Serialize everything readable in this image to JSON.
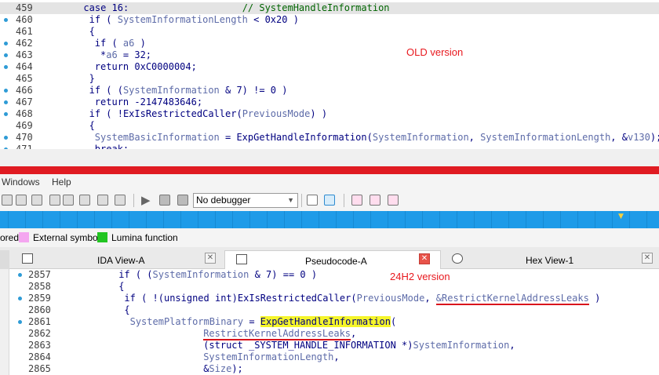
{
  "old_pane": {
    "annotation": "OLD version",
    "lines": [
      {
        "num": "459",
        "dot": false,
        "indent": 14,
        "parts": [
          [
            "kw",
            "case 16:"
          ],
          [
            "sp",
            "                    "
          ],
          [
            "com",
            "// SystemHandleInformation"
          ]
        ]
      },
      {
        "num": "460",
        "dot": true,
        "indent": 16,
        "parts": [
          [
            "kw",
            "if ( "
          ],
          [
            "var",
            "SystemInformationLength"
          ],
          [
            "kw",
            " < 0x20 )"
          ]
        ]
      },
      {
        "num": "461",
        "dot": false,
        "indent": 16,
        "parts": [
          [
            "kw",
            "{"
          ]
        ]
      },
      {
        "num": "462",
        "dot": true,
        "indent": 18,
        "parts": [
          [
            "kw",
            "if ( "
          ],
          [
            "var",
            "a6"
          ],
          [
            "kw",
            " )"
          ]
        ]
      },
      {
        "num": "463",
        "dot": true,
        "indent": 20,
        "parts": [
          [
            "kw",
            "*"
          ],
          [
            "var",
            "a6"
          ],
          [
            "kw",
            " = 32;"
          ]
        ]
      },
      {
        "num": "464",
        "dot": true,
        "indent": 18,
        "parts": [
          [
            "kw",
            "return 0xC0000004;"
          ]
        ]
      },
      {
        "num": "465",
        "dot": false,
        "indent": 16,
        "parts": [
          [
            "kw",
            "}"
          ]
        ]
      },
      {
        "num": "466",
        "dot": true,
        "indent": 16,
        "parts": [
          [
            "kw",
            "if ( ("
          ],
          [
            "var",
            "SystemInformation"
          ],
          [
            "kw",
            " & 7) != 0 )"
          ]
        ]
      },
      {
        "num": "467",
        "dot": true,
        "indent": 18,
        "parts": [
          [
            "kw",
            "return -2147483646;"
          ]
        ]
      },
      {
        "num": "468",
        "dot": true,
        "indent": 16,
        "parts": [
          [
            "kw",
            "if ( !"
          ],
          [
            "fn",
            "ExIsRestrictedCaller"
          ],
          [
            "kw",
            "("
          ],
          [
            "var",
            "PreviousMode"
          ],
          [
            "kw",
            ") )"
          ]
        ]
      },
      {
        "num": "469",
        "dot": false,
        "indent": 16,
        "parts": [
          [
            "kw",
            "{"
          ]
        ]
      },
      {
        "num": "470",
        "dot": true,
        "indent": 18,
        "parts": [
          [
            "var",
            "SystemBasicInformation"
          ],
          [
            "kw",
            " = "
          ],
          [
            "fn",
            "ExpGetHandleInformation"
          ],
          [
            "kw",
            "("
          ],
          [
            "var",
            "SystemInformation"
          ],
          [
            "kw",
            ", "
          ],
          [
            "var",
            "SystemInformationLength"
          ],
          [
            "kw",
            ", &"
          ],
          [
            "var",
            "v130"
          ],
          [
            "kw",
            ");"
          ]
        ]
      },
      {
        "num": "471",
        "dot": true,
        "indent": 18,
        "parts": [
          [
            "kw",
            "break;"
          ]
        ]
      }
    ]
  },
  "menubar": {
    "items": [
      "Windows",
      "Help"
    ]
  },
  "toolbar": {
    "debugger": "No debugger"
  },
  "legend": {
    "items": [
      {
        "label": "ored",
        "color": ""
      },
      {
        "label": "External symbol",
        "color": "#f4a6f0"
      },
      {
        "label": "Lumina function",
        "color": "#22c522"
      }
    ]
  },
  "tabs": [
    {
      "label": "IDA View-A",
      "active": false
    },
    {
      "label": "Pseudocode-A",
      "active": true
    },
    {
      "label": "Hex View-1",
      "active": false
    }
  ],
  "new_pane": {
    "annotation": "24H2 version",
    "lines": [
      {
        "num": "2857",
        "dot": true,
        "indent": 22,
        "parts": [
          [
            "kw",
            "if ( ("
          ],
          [
            "var",
            "SystemInformation"
          ],
          [
            "kw",
            " & 7) == 0 )"
          ]
        ]
      },
      {
        "num": "2858",
        "dot": false,
        "indent": 22,
        "parts": [
          [
            "kw",
            "{"
          ]
        ]
      },
      {
        "num": "2859",
        "dot": true,
        "indent": 24,
        "parts": [
          [
            "kw",
            "if ( !(unsigned int)"
          ],
          [
            "fn",
            "ExIsRestrictedCaller"
          ],
          [
            "kw",
            "("
          ],
          [
            "var",
            "PreviousMode"
          ],
          [
            "kw",
            ", "
          ],
          [
            "ul",
            "&RestrictKernelAddressLeaks"
          ],
          [
            "kw",
            " )"
          ]
        ]
      },
      {
        "num": "2860",
        "dot": false,
        "indent": 24,
        "parts": [
          [
            "kw",
            "{"
          ]
        ]
      },
      {
        "num": "2861",
        "dot": true,
        "indent": 26,
        "parts": [
          [
            "var",
            "SystemPlatformBinary"
          ],
          [
            "kw",
            " = "
          ],
          [
            "yl",
            "ExpGetHandleInformation"
          ],
          [
            "kw",
            "("
          ]
        ]
      },
      {
        "num": "2862",
        "dot": false,
        "indent": 52,
        "parts": [
          [
            "ul",
            "RestrictKernelAddressLeaks"
          ],
          [
            "kw",
            ","
          ]
        ]
      },
      {
        "num": "2863",
        "dot": false,
        "indent": 52,
        "parts": [
          [
            "kw",
            "(struct _SYSTEM_HANDLE_INFORMATION *)"
          ],
          [
            "var",
            "SystemInformation"
          ],
          [
            "kw",
            ","
          ]
        ]
      },
      {
        "num": "2864",
        "dot": false,
        "indent": 52,
        "parts": [
          [
            "var",
            "SystemInformationLength"
          ],
          [
            "kw",
            ","
          ]
        ]
      },
      {
        "num": "2865",
        "dot": false,
        "indent": 52,
        "parts": [
          [
            "kw",
            "&"
          ],
          [
            "var",
            "Size"
          ],
          [
            "kw",
            ");"
          ]
        ]
      }
    ]
  },
  "colors": {
    "accent_red": "#e01b22",
    "nav_blue": "#1f9be8",
    "highlight_yellow": "#f5f52a"
  }
}
